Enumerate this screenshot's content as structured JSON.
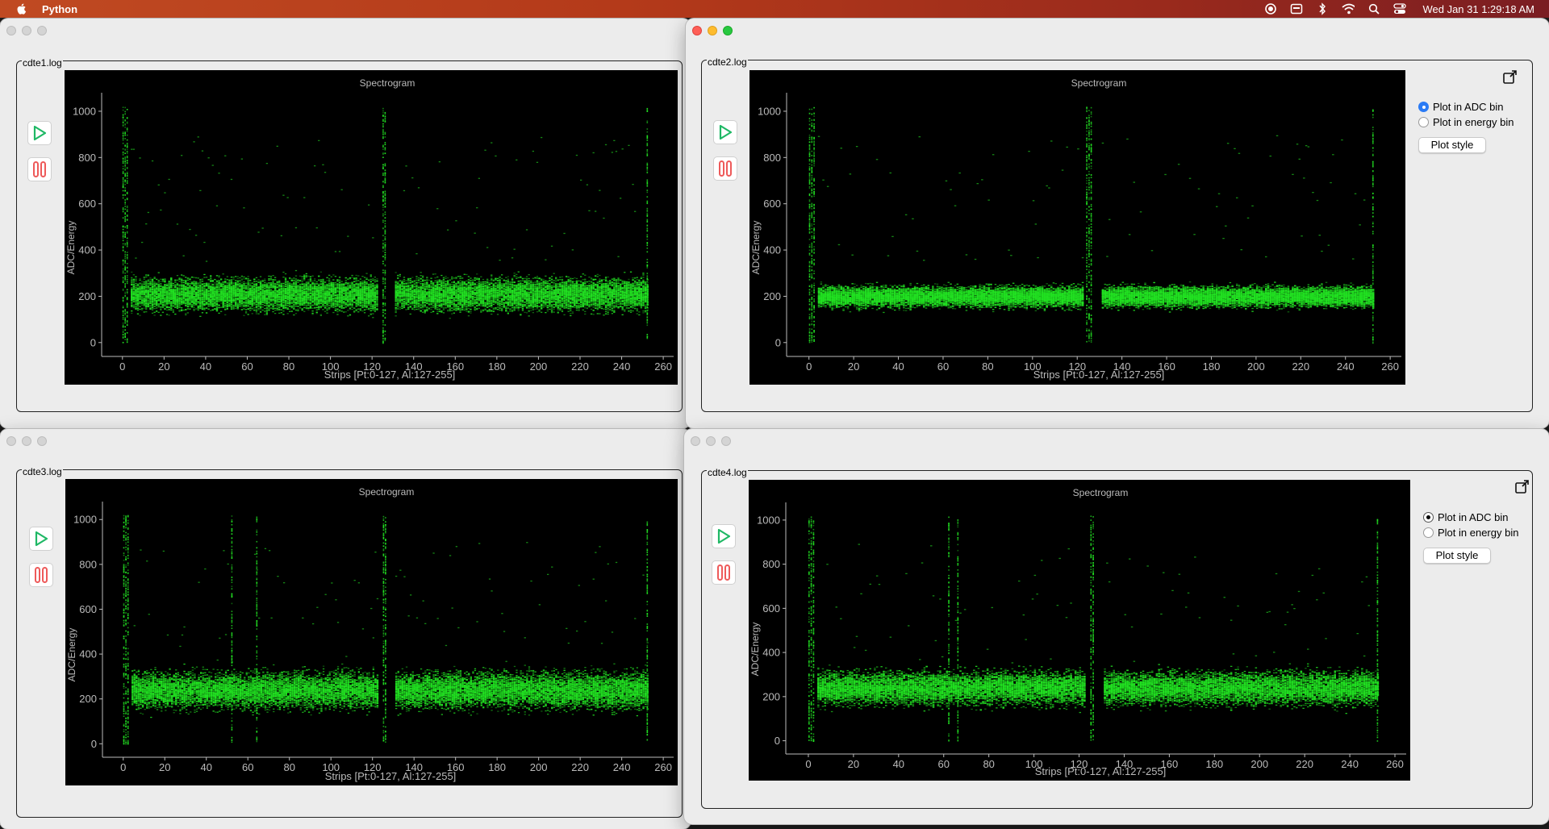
{
  "menubar": {
    "app_name": "Python",
    "clock": "Wed Jan 31  1:29:18 AM"
  },
  "colors": {
    "plot_bg": "#000000",
    "signal_green": "#22e022",
    "axis_text": "#bbbbbb",
    "radio_selected": "#2a7bf5",
    "play_icon": "#1fb865",
    "pause_icon": "#ee5a5a"
  },
  "panels": [
    {
      "group_title": "cdte1.log",
      "plot": {
        "title": "Spectrogram",
        "xlabel": "Strips [Pt:0-127, Al:127-255]",
        "ylabel": "ADC/Energy"
      },
      "has_options": false
    },
    {
      "group_title": "cdte2.log",
      "plot": {
        "title": "Spectrogram",
        "xlabel": "Strips [Pt:0-127, Al:127-255]",
        "ylabel": "ADC/Energy"
      },
      "has_options": true,
      "options": {
        "radio_adc": "Plot in ADC bin",
        "radio_energy": "Plot in energy bin",
        "selected": "radio_adc",
        "plot_style": "Plot style"
      }
    },
    {
      "group_title": "cdte3.log",
      "plot": {
        "title": "Spectrogram",
        "xlabel": "Strips [Pt:0-127, Al:127-255]",
        "ylabel": "ADC/Energy"
      },
      "has_options": false
    },
    {
      "group_title": "cdte4.log",
      "plot": {
        "title": "Spectrogram",
        "xlabel": "Strips [Pt:0-127, Al:127-255]",
        "ylabel": "ADC/Energy"
      },
      "has_options": true,
      "options": {
        "radio_adc": "Plot in ADC bin",
        "radio_energy": "Plot in energy bin",
        "selected": "radio_adc",
        "plot_style": "Plot style"
      }
    }
  ],
  "chart_data": [
    {
      "type": "heatmap",
      "title": "Spectrogram",
      "xlabel": "Strips [Pt:0-127, Al:127-255]",
      "ylabel": "ADC/Energy",
      "xlim": [
        -10,
        265
      ],
      "ylim": [
        -60,
        1080
      ],
      "xticks": [
        0,
        20,
        40,
        60,
        80,
        100,
        120,
        140,
        160,
        180,
        200,
        220,
        240,
        260
      ],
      "yticks": [
        0,
        200,
        400,
        600,
        800,
        1000
      ],
      "band": {
        "strip_range": [
          4,
          252
        ],
        "adc_center": 210,
        "adc_spread": 70
      },
      "hot_strips": [
        0,
        1,
        2,
        125,
        126,
        252
      ]
    },
    {
      "type": "heatmap",
      "title": "Spectrogram",
      "xlabel": "Strips [Pt:0-127, Al:127-255]",
      "ylabel": "ADC/Energy",
      "xlim": [
        -10,
        265
      ],
      "ylim": [
        -60,
        1080
      ],
      "xticks": [
        0,
        20,
        40,
        60,
        80,
        100,
        120,
        140,
        160,
        180,
        200,
        220,
        240,
        260
      ],
      "yticks": [
        0,
        200,
        400,
        600,
        800,
        1000
      ],
      "band": {
        "strip_range": [
          4,
          252
        ],
        "adc_center": 200,
        "adc_spread": 45
      },
      "hot_strips": [
        0,
        1,
        2,
        124,
        125,
        126,
        252
      ]
    },
    {
      "type": "heatmap",
      "title": "Spectrogram",
      "xlabel": "Strips [Pt:0-127, Al:127-255]",
      "ylabel": "ADC/Energy",
      "xlim": [
        -10,
        265
      ],
      "ylim": [
        -60,
        1080
      ],
      "xticks": [
        0,
        20,
        40,
        60,
        80,
        100,
        120,
        140,
        160,
        180,
        200,
        220,
        240,
        260
      ],
      "yticks": [
        0,
        200,
        400,
        600,
        800,
        1000
      ],
      "band": {
        "strip_range": [
          4,
          252
        ],
        "adc_center": 240,
        "adc_spread": 80
      },
      "hot_strips": [
        0,
        1,
        2,
        52,
        64,
        125,
        126,
        252
      ]
    },
    {
      "type": "heatmap",
      "title": "Spectrogram",
      "xlabel": "Strips [Pt:0-127, Al:127-255]",
      "ylabel": "ADC/Energy",
      "xlim": [
        -10,
        265
      ],
      "ylim": [
        -60,
        1080
      ],
      "xticks": [
        0,
        20,
        40,
        60,
        80,
        100,
        120,
        140,
        160,
        180,
        200,
        220,
        240,
        260
      ],
      "yticks": [
        0,
        200,
        400,
        600,
        800,
        1000
      ],
      "band": {
        "strip_range": [
          4,
          252
        ],
        "adc_center": 240,
        "adc_spread": 75
      },
      "hot_strips": [
        0,
        1,
        2,
        62,
        66,
        125,
        126,
        252
      ]
    }
  ]
}
